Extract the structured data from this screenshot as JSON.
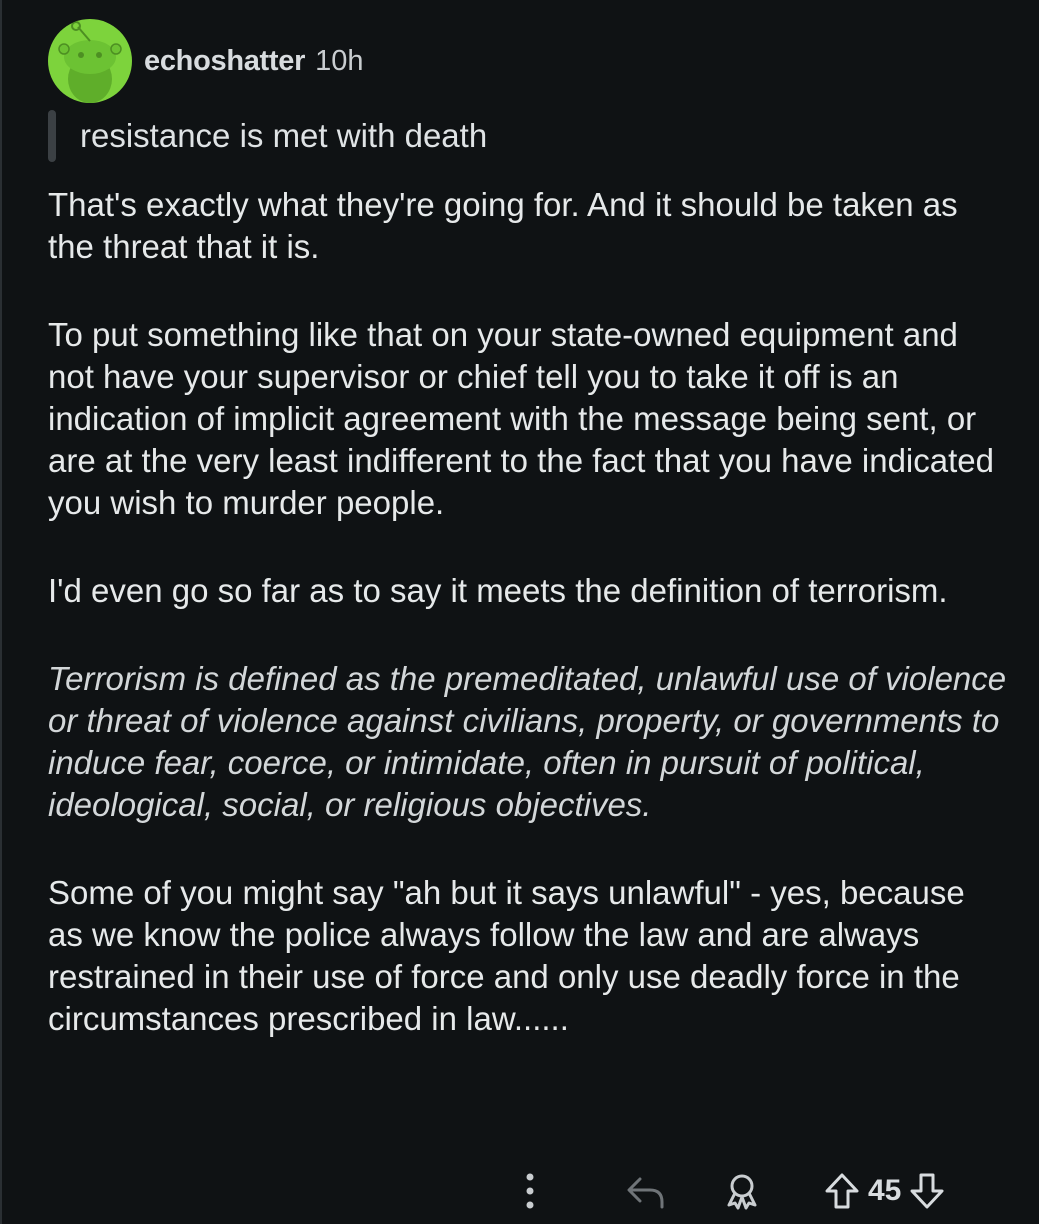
{
  "comment": {
    "username": "echoshatter",
    "time": "10h",
    "quote": "resistance is met with death",
    "paragraphs": [
      "That's exactly what they're going for. And it should be taken as the threat that it is.",
      "To put something like that on your state-owned equipment and not have your supervisor or chief tell you to take it off is an indication of implicit agreement with the message being sent, or are at the very least indifferent to the fact that you have indicated you wish to murder people.",
      "I'd even go so far as to say it meets the definition of terrorism.",
      "Terrorism is defined as the premeditated, unlawful use of violence or threat of violence against civilians, property, or governments to induce fear, coerce, or intimidate, often in pursuit of political, ideological, social, or religious objectives.",
      "Some of you might say \"ah but it says unlawful\" - yes, because as we know the police always follow the law and are always restrained in their use of force and only use deadly force in the circumstances prescribed in law......"
    ],
    "score": "45"
  },
  "icons": {
    "avatar": "snoo-avatar",
    "more": "more-vertical-icon",
    "reply": "reply-icon",
    "award": "award-icon",
    "upvote": "upvote-arrow-icon",
    "downvote": "downvote-arrow-icon"
  },
  "colors": {
    "background": "#0f1214",
    "avatar_bg": "#7dd33c",
    "text": "#e6e9ea"
  }
}
